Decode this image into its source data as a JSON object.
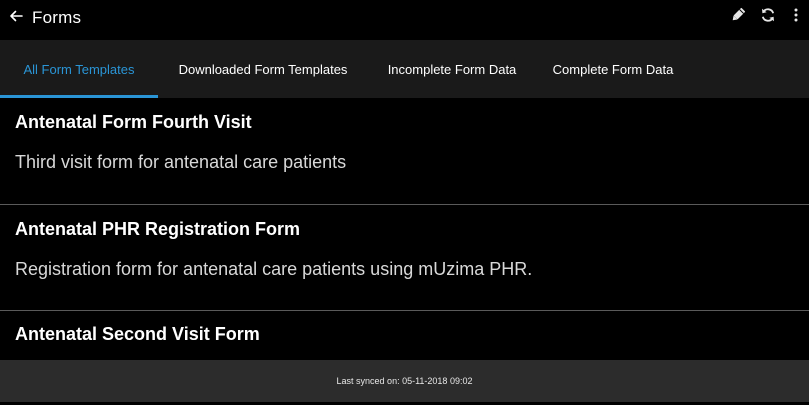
{
  "header": {
    "back_icon": "arrow-left-icon",
    "title": "Forms",
    "actions": [
      {
        "name": "edit",
        "icon": "pencil-icon"
      },
      {
        "name": "sync",
        "icon": "sync-icon"
      },
      {
        "name": "overflow",
        "icon": "more-vertical-icon"
      }
    ]
  },
  "tabs": [
    {
      "label": "All Form Templates",
      "active": true
    },
    {
      "label": "Downloaded Form Templates",
      "active": false
    },
    {
      "label": "Incomplete Form Data",
      "active": false
    },
    {
      "label": "Complete Form Data",
      "active": false
    }
  ],
  "forms": [
    {
      "title": "Antenatal Form Fourth Visit",
      "description": "Third visit form for antenatal care patients"
    },
    {
      "title": "Antenatal PHR  Registration Form",
      "description": "Registration form for antenatal care patients using mUzima PHR."
    },
    {
      "title": "Antenatal Second Visit Form",
      "description": ""
    }
  ],
  "footer": {
    "sync_status": "Last synced on: 05-11-2018 09:02"
  },
  "colors": {
    "accent": "#2a95d6",
    "background": "#000000",
    "tab_bar": "#1a1a1a",
    "footer": "#2c2c2c"
  }
}
